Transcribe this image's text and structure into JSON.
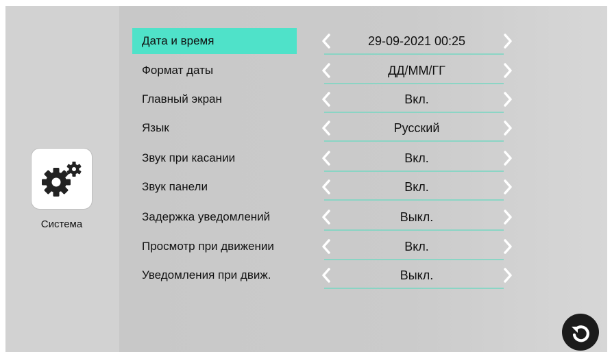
{
  "sidebar": {
    "app_label": "Система",
    "app_icon": "gears-icon"
  },
  "settings": [
    {
      "label": "Дата и время",
      "value": "29-09-2021 00:25",
      "selected": true
    },
    {
      "label": "Формат даты",
      "value": "ДД/ММ/ГГ",
      "selected": false
    },
    {
      "label": "Главный экран",
      "value": "Вкл.",
      "selected": false
    },
    {
      "label": "Язык",
      "value": "Русский",
      "selected": false
    },
    {
      "label": "Звук при касании",
      "value": "Вкл.",
      "selected": false
    },
    {
      "label": "Звук панели",
      "value": "Вкл.",
      "selected": false
    },
    {
      "label": "Задержка уведомлений",
      "value": "Выкл.",
      "selected": false
    },
    {
      "label": "Просмотр при движении",
      "value": "Вкл.",
      "selected": false
    },
    {
      "label": "Уведомления при движ.",
      "value": "Выкл.",
      "selected": false
    }
  ],
  "controls": {
    "prev_icon": "chevron-left-icon",
    "next_icon": "chevron-right-icon",
    "back_icon": "undo-arrow-icon"
  },
  "colors": {
    "selected_highlight": "#4fe2c9",
    "underline": "#7fd6c3",
    "chevron": "#ffffff",
    "back_button": "#1b1b1b"
  }
}
